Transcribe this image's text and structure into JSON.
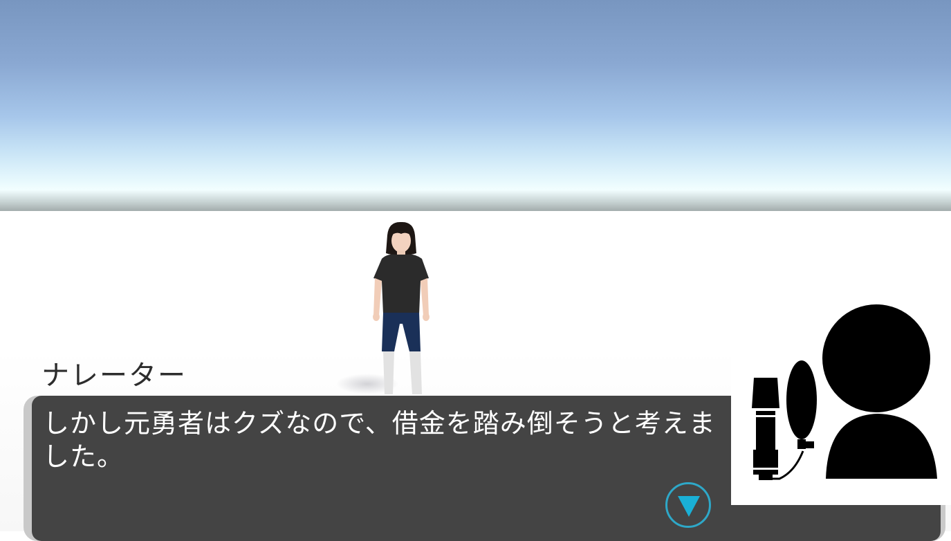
{
  "scene": {
    "sky_colors": [
      "#7896c0",
      "#a6c6ea",
      "#e8f9fd"
    ],
    "ground_color": "#ffffff"
  },
  "dialog": {
    "speaker": "ナレーター",
    "message": "しかし元勇者はクズなので、借金を踏み倒そうと考えました。",
    "box_color": "#444444",
    "accent_color": "#1ab0d6",
    "next_icon": "triangle-down-icon"
  },
  "voice_indicator": {
    "icon": "microphone-speaker-icon",
    "color": "#000000"
  }
}
